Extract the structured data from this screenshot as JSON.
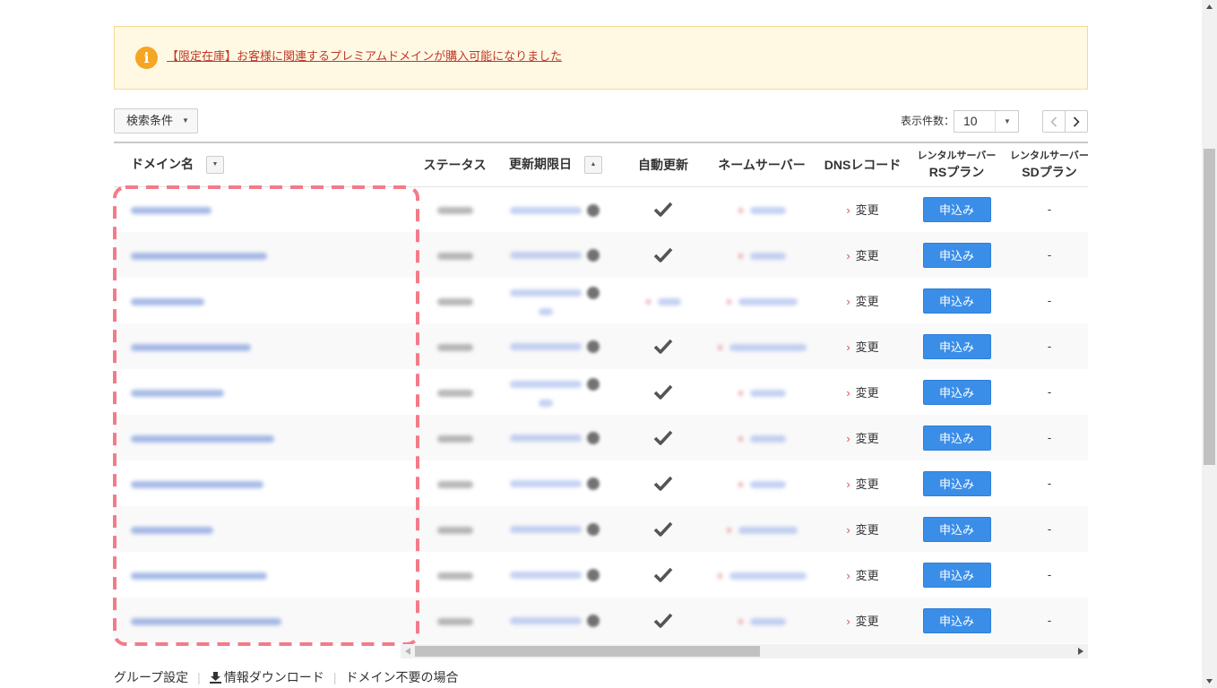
{
  "notice": {
    "icon": "info-icon",
    "text": "【限定在庫】お客様に関連するプレミアムドメインが購入可能になりました"
  },
  "toolbar": {
    "search_conditions_label": "検索条件",
    "per_page_label": "表示件数：",
    "per_page_value": "10"
  },
  "table": {
    "headers": {
      "domain": "ドメイン名",
      "status": "ステータス",
      "expiry": "更新期限日",
      "auto_renew": "自動更新",
      "nameserver": "ネームサーバー",
      "dns": "DNSレコード",
      "rs_top": "レンタルサーバー",
      "rs_bottom": "RSプラン",
      "sd_top": "レンタルサーバー",
      "sd_bottom": "SDプラン"
    },
    "rows": [
      {
        "auto_renew": true,
        "dns_label": "変更",
        "rs_button": "申込み",
        "sd_value": "-"
      },
      {
        "auto_renew": true,
        "dns_label": "変更",
        "rs_button": "申込み",
        "sd_value": "-"
      },
      {
        "auto_renew": null,
        "dns_label": "変更",
        "rs_button": "申込み",
        "sd_value": "-"
      },
      {
        "auto_renew": true,
        "dns_label": "変更",
        "rs_button": "申込み",
        "sd_value": "-"
      },
      {
        "auto_renew": true,
        "dns_label": "変更",
        "rs_button": "申込み",
        "sd_value": "-"
      },
      {
        "auto_renew": true,
        "dns_label": "変更",
        "rs_button": "申込み",
        "sd_value": "-"
      },
      {
        "auto_renew": true,
        "dns_label": "変更",
        "rs_button": "申込み",
        "sd_value": "-"
      },
      {
        "auto_renew": true,
        "dns_label": "変更",
        "rs_button": "申込み",
        "sd_value": "-"
      },
      {
        "auto_renew": true,
        "dns_label": "変更",
        "rs_button": "申込み",
        "sd_value": "-"
      },
      {
        "auto_renew": true,
        "dns_label": "変更",
        "rs_button": "申込み",
        "sd_value": "-"
      }
    ]
  },
  "footer": {
    "group_settings": "グループ設定",
    "download": "情報ダウンロード",
    "download_icon": "download-icon",
    "no_domain": "ドメイン不要の場合"
  },
  "colors": {
    "accent": "#3b8ee8",
    "notice_link": "#c0392b",
    "notice_icon": "#f5a623",
    "highlight": "#f37b89",
    "dns_chevron": "#d9534f"
  }
}
